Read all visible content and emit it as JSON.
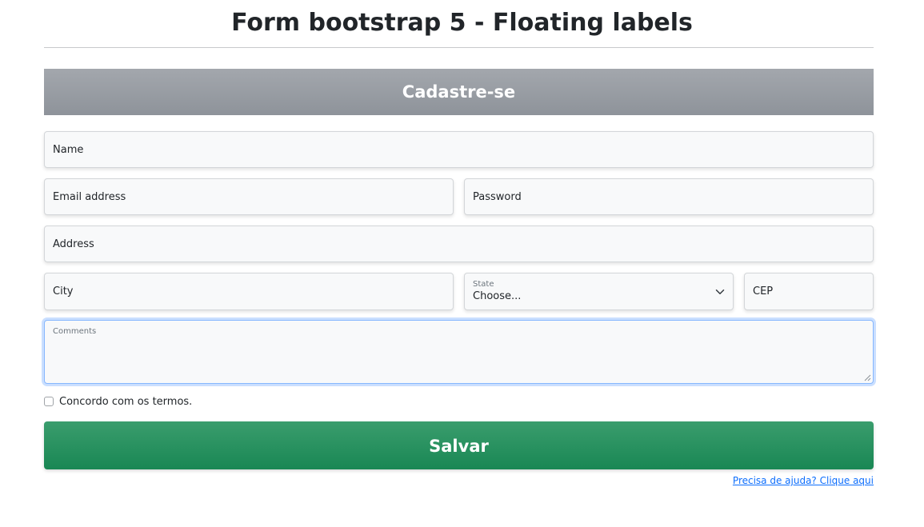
{
  "page": {
    "title": "Form bootstrap 5 - Floating labels"
  },
  "form": {
    "banner_title": "Cadastre-se",
    "fields": {
      "name": {
        "label": "Name",
        "value": ""
      },
      "email": {
        "label": "Email address",
        "value": ""
      },
      "password": {
        "label": "Password",
        "value": ""
      },
      "address": {
        "label": "Address",
        "value": ""
      },
      "city": {
        "label": "City",
        "value": ""
      },
      "state": {
        "label": "State",
        "selected": "Choose..."
      },
      "cep": {
        "label": "CEP",
        "value": ""
      },
      "comments": {
        "label": "Comments",
        "value": ""
      }
    },
    "terms": {
      "label": "Concordo com os termos.",
      "checked": false
    },
    "submit_label": "Salvar",
    "help_link": "Precisa de ajuda? Clique aqui"
  },
  "colors": {
    "banner": "#969ba2",
    "submit": "#198754",
    "link": "#0d6efd",
    "focus_border": "#86b7fe"
  },
  "icons": {
    "state_select": "chevron-down-icon",
    "comments_resize": "resize-handle-icon"
  }
}
